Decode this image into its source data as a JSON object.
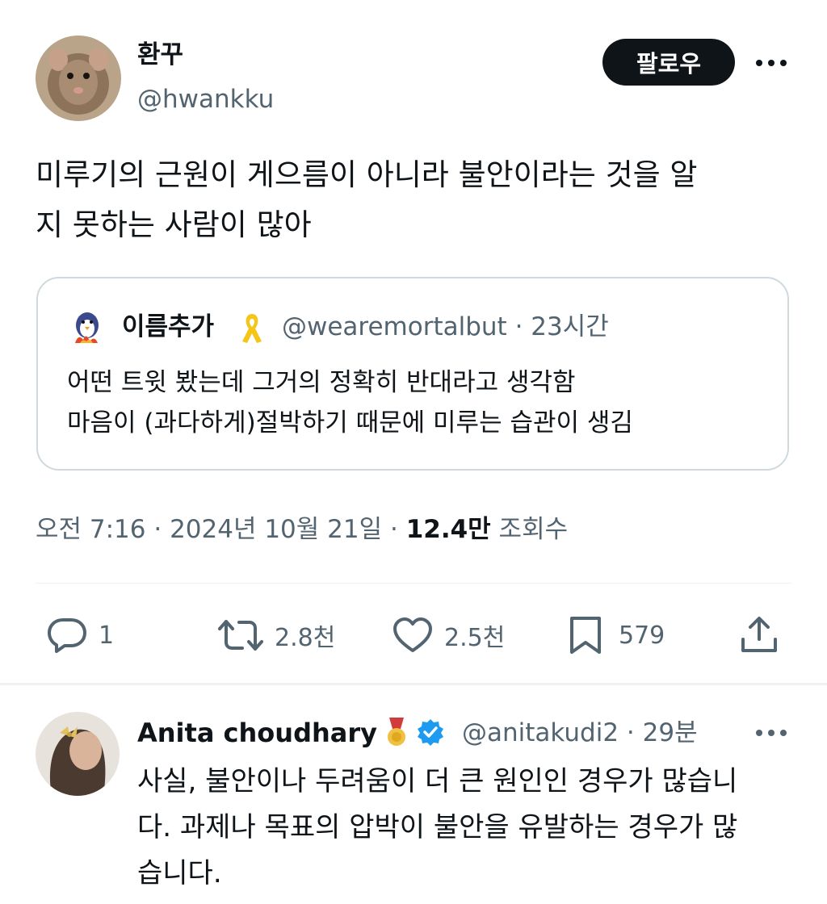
{
  "author": {
    "display_name": "환꾸",
    "handle": "@hwankku",
    "follow_label": "팔로우"
  },
  "tweet": {
    "text": "미루기의 근원이 게으름이 아니라 불안이라는 것을 알\n지 못하는 사람이 많아"
  },
  "quote": {
    "display_name": "이름추가",
    "meta": "@wearemortalbut · 23시간",
    "text": "어떤 트윗 봤는데 그거의 정확히 반대라고 생각함\n마음이 (과다하게)절박하기 때문에 미루는 습관이 생김"
  },
  "meta": {
    "time_date": "오전 7:16 · 2024년 10월 21일 · ",
    "views_count": "12.4만",
    "views_label": " 조회수"
  },
  "actions": {
    "replies": "1",
    "retweets": "2.8천",
    "likes": "2.5천",
    "bookmarks": "579"
  },
  "reply": {
    "display_name": "Anita choudhary",
    "meta": "@anitakudi2 · 29분",
    "text": "사실, 불안이나 두려움이 더 큰 원인인 경우가 많습니\n다. 과제나 목표의 압박이 불안을 유발하는 경우가 많\n습니다."
  },
  "colors": {
    "follow_bg": "#0f1419",
    "muted_text": "#536471",
    "verified": "#1d9bf0",
    "ribbon": "#f5c518"
  },
  "icons": [
    "more-icon",
    "reply-icon",
    "retweet-icon",
    "like-icon",
    "bookmark-icon",
    "share-icon",
    "yellow-ribbon-icon",
    "verified-badge-icon",
    "medal-icon"
  ]
}
